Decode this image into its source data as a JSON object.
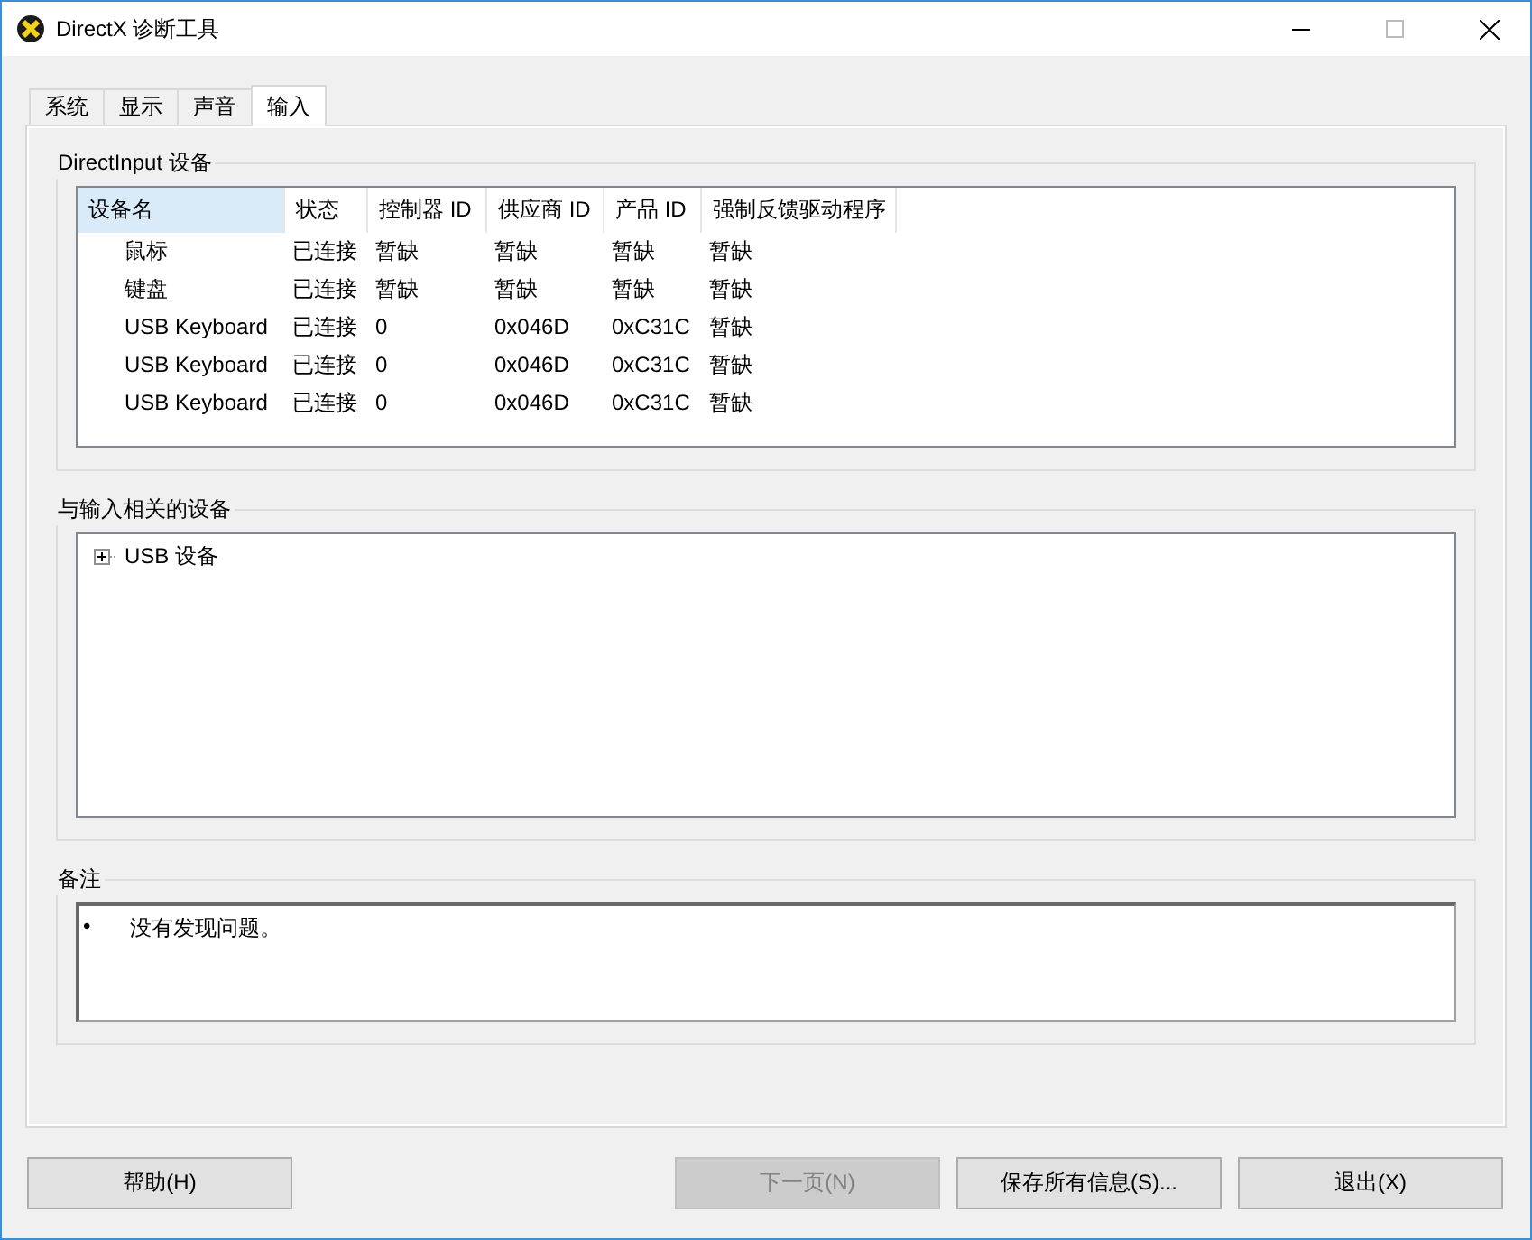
{
  "window": {
    "title": "DirectX 诊断工具"
  },
  "tabs": [
    {
      "label": "系统",
      "selected": false
    },
    {
      "label": "显示",
      "selected": false
    },
    {
      "label": "声音",
      "selected": false
    },
    {
      "label": "输入",
      "selected": true
    }
  ],
  "directinput": {
    "title": "DirectInput 设备",
    "columns": [
      {
        "label": "设备名",
        "selected": true
      },
      {
        "label": "状态",
        "selected": false
      },
      {
        "label": "控制器 ID",
        "selected": false
      },
      {
        "label": "供应商 ID",
        "selected": false
      },
      {
        "label": "产品 ID",
        "selected": false
      },
      {
        "label": "强制反馈驱动程序",
        "selected": false
      }
    ],
    "rows": [
      [
        "鼠标",
        "已连接",
        "暂缺",
        "暂缺",
        "暂缺",
        "暂缺"
      ],
      [
        "键盘",
        "已连接",
        "暂缺",
        "暂缺",
        "暂缺",
        "暂缺"
      ],
      [
        "USB Keyboard",
        "已连接",
        "0",
        "0x046D",
        "0xC31C",
        "暂缺"
      ],
      [
        "USB Keyboard",
        "已连接",
        "0",
        "0x046D",
        "0xC31C",
        "暂缺"
      ],
      [
        "USB Keyboard",
        "已连接",
        "0",
        "0x046D",
        "0xC31C",
        "暂缺"
      ]
    ]
  },
  "related": {
    "title": "与输入相关的设备",
    "items": [
      {
        "label": "USB 设备",
        "expanded": false
      }
    ]
  },
  "notes": {
    "title": "备注",
    "items": [
      {
        "bullet": "•",
        "text": "没有发现问题。"
      }
    ]
  },
  "buttons": [
    {
      "label": "帮助(H)",
      "disabled": false
    },
    {
      "label": "下一页(N)",
      "disabled": true
    },
    {
      "label": "保存所有信息(S)...",
      "disabled": false
    },
    {
      "label": "退出(X)",
      "disabled": false
    }
  ]
}
